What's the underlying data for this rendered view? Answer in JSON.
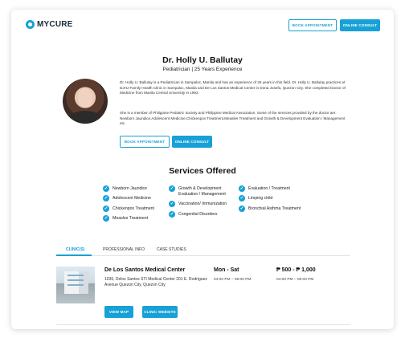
{
  "header": {
    "logo_text": "MYCURE",
    "book_label": "BOOK APPOINTMENT",
    "consult_label": "ONLINE CONSULT"
  },
  "doctor": {
    "name": "Dr. Holly U. Ballutay",
    "subtitle": "Pediatrician | 25 Years Experience",
    "bio_1": "Dr. Holly U. Ballutay is a Pediatrician in Sampaloc, Manila and has an experience of 25 years in this field. Dr. Holly U. Ballutay practices at DJHJ Family Health Clinic in Sampaloc, Manila and De Los Santos Medical Center in Dona Josefa, Quezon City. She completed Doctor of Medicine from Manila Central University in 1992.",
    "bio_2": "She is a member of Philippine Pediatric Society and Philippine Medical Association. Some of the services provided by the doctor are: Newborn Jaundice,Adolescent Medicine,Chickenpox Treatment,Measles Treatment and Growth & Development Evaluation / Management etc.",
    "book_label": "BOOK APPOINTMENT",
    "consult_label": "ONLINE CONSULT"
  },
  "services": {
    "title": "Services Offered",
    "col1": [
      "Newborn Jaundice",
      "Adolescent Medicine",
      "Chickenpox Treatment",
      "Measles Treatment"
    ],
    "col2": [
      "Growth & Development Evaluation / Management",
      "Vaccination/ Immunization",
      "Congenital Disorders"
    ],
    "col3": [
      "Evaluation / Treatment",
      "Limping child",
      "Bronchial Asthma Treatment"
    ]
  },
  "tabs": [
    "CLINIC(S)",
    "PROFESSIONAL INFO",
    "CASE STUDIES"
  ],
  "clinic": {
    "name": "De Los Santos Medical Center",
    "address": "1036, Delos Santos STI Medical Center 201 E. Rodriguez Avenue Quezon City, Quezon City",
    "days": "Mon - Sat",
    "time_1": "04:00 PM – 09:00 PM",
    "fee": "₱ 500 - ₱ 1,000",
    "time_2": "04:00 PM – 09:00 PM",
    "view_map_label": "VIEW MAP",
    "website_label": "CLINIC WEBSITE"
  },
  "colors": {
    "accent": "#17a1d6"
  }
}
